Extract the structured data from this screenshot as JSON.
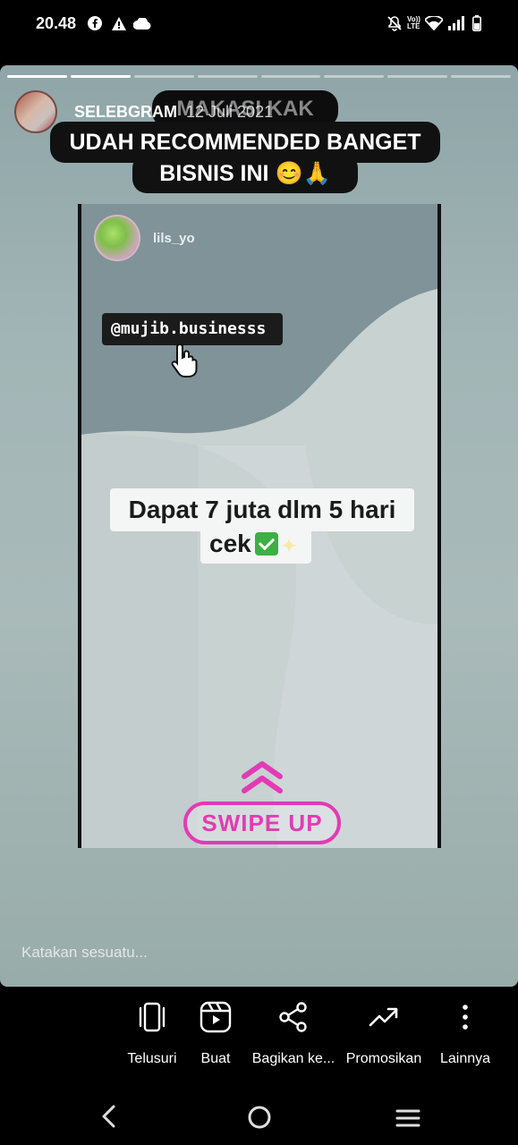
{
  "status_bar": {
    "time": "20.48",
    "icons": [
      "facebook-icon",
      "alert-icon",
      "cloud-icon",
      "mute-icon",
      "volte-icon",
      "wifi-icon",
      "signal-icon",
      "battery-icon"
    ],
    "volte_text": "Vo)) LTE"
  },
  "story": {
    "progress_segments": 8,
    "progress_done": 2,
    "username": "SELEBGRAM",
    "date": "12 Juli 2021",
    "overlay_lines": [
      "MAKASI KAK",
      "UDAH RECOMMENDED BANGET",
      "BISNIS INI 😊🙏"
    ],
    "inner": {
      "username": "lils_yo",
      "mention": "@mujib.businesss",
      "caption_line1": "Dapat 7 juta dlm 5 hari",
      "caption_line2": "cek",
      "swipe_label": "SWIPE UP"
    },
    "reply_placeholder": "Katakan sesuatu..."
  },
  "actions": [
    {
      "label": "Telusuri",
      "icon": "explore-icon"
    },
    {
      "label": "Buat",
      "icon": "reels-icon"
    },
    {
      "label": "Bagikan ke...",
      "icon": "share-icon"
    },
    {
      "label": "Promosikan",
      "icon": "trending-icon"
    },
    {
      "label": "Lainnya",
      "icon": "more-vertical-icon"
    }
  ],
  "nav": [
    "back-icon",
    "home-icon",
    "recents-icon"
  ],
  "colors": {
    "swipe_accent": "#e33ab5",
    "check_green": "#3cb043",
    "background": "#000000"
  }
}
